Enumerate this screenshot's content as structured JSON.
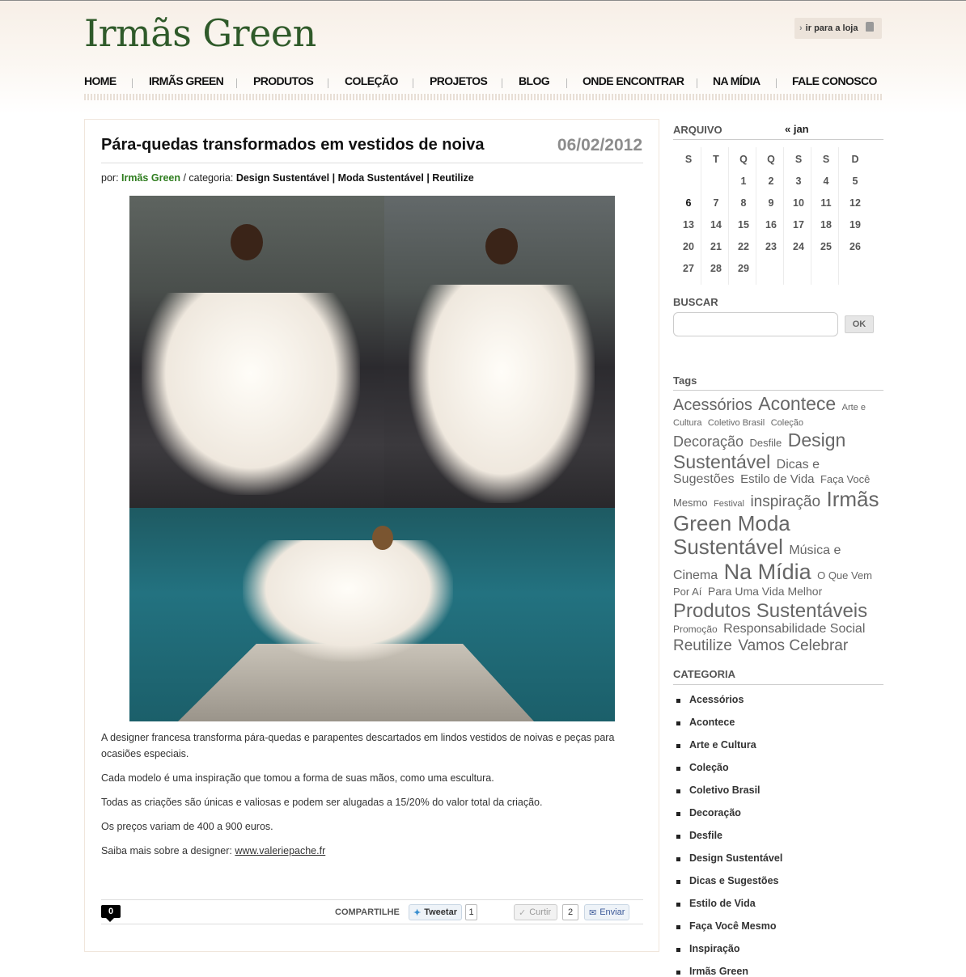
{
  "brand": {
    "logo": "Irmãs Green",
    "store_link": "ir para a loja"
  },
  "nav": [
    "HOME",
    "IRMÃS GREEN",
    "PRODUTOS",
    "COLEÇÃO",
    "PROJETOS",
    "BLOG",
    "ONDE ENCONTRAR",
    "NA MÍDIA",
    "FALE CONOSCO"
  ],
  "post": {
    "title": "Pára-quedas transformados em vestidos de noiva",
    "date": "06/02/2012",
    "by_label": "por:",
    "author": "Irmãs Green",
    "category_label": "/ categoria:",
    "categories": "Design Sustentável | Moda Sustentável | Reutilize",
    "paragraphs": [
      "A designer francesa transforma pára-quedas e parapentes descartados em lindos vestidos de noivas e peças para ocasiões especiais.",
      "Cada modelo é uma inspiração que tomou a forma de suas mãos, como uma escultura.",
      "Todas as criações são únicas e valiosas e podem ser alugadas a 15/20% do valor total da criação.",
      "Os preços variam de 400 a 900 euros."
    ],
    "more_text": "Saiba mais sobre  a designer:",
    "more_link": "www.valeriepache.fr",
    "comments_count": "0",
    "share_label": "COMPARTILHE",
    "tweet_label": "Tweetar",
    "tweet_count": "1",
    "like_label": "Curtir",
    "like_count": "2",
    "send_label": "Enviar"
  },
  "archive": {
    "heading": "ARQUIVO",
    "prev_link": "« jan",
    "weekdays": [
      "S",
      "T",
      "Q",
      "Q",
      "S",
      "S",
      "D"
    ],
    "weeks": [
      [
        "",
        "",
        "1",
        "2",
        "3",
        "4",
        "5"
      ],
      [
        "6",
        "7",
        "8",
        "9",
        "10",
        "11",
        "12"
      ],
      [
        "13",
        "14",
        "15",
        "16",
        "17",
        "18",
        "19"
      ],
      [
        "20",
        "21",
        "22",
        "23",
        "24",
        "25",
        "26"
      ],
      [
        "27",
        "28",
        "29",
        "",
        "",
        "",
        ""
      ]
    ]
  },
  "search": {
    "heading": "BUSCAR",
    "button": "OK",
    "placeholder": ""
  },
  "tags": {
    "heading": "Tags",
    "items": [
      {
        "t": "Acessórios",
        "s": 20
      },
      {
        "t": "Acontece",
        "s": 23
      },
      {
        "t": "Arte e Cultura",
        "s": 11
      },
      {
        "t": "Coletivo Brasil",
        "s": 11
      },
      {
        "t": "Coleção",
        "s": 11
      },
      {
        "t": "Decoração",
        "s": 18
      },
      {
        "t": "Desfile",
        "s": 13
      },
      {
        "t": "Design Sustentável",
        "s": 23
      },
      {
        "t": "Dicas e Sugestões",
        "s": 16
      },
      {
        "t": "Estilo de Vida",
        "s": 15
      },
      {
        "t": "Faça Você Mesmo",
        "s": 13
      },
      {
        "t": "Festival",
        "s": 11
      },
      {
        "t": "inspiração",
        "s": 19
      },
      {
        "t": "Irmãs Green",
        "s": 26
      },
      {
        "t": "Moda Sustentável",
        "s": 26
      },
      {
        "t": "Música e Cinema",
        "s": 16
      },
      {
        "t": "Na Mídia",
        "s": 27
      },
      {
        "t": "O Que Vem Por Aí",
        "s": 13
      },
      {
        "t": "Para Uma Vida Melhor",
        "s": 14
      },
      {
        "t": "Produtos Sustentáveis",
        "s": 24
      },
      {
        "t": "Promoção",
        "s": 12
      },
      {
        "t": "Responsabilidade Social",
        "s": 16
      },
      {
        "t": "Reutilize",
        "s": 19
      },
      {
        "t": "Vamos Celebrar",
        "s": 19
      }
    ]
  },
  "categoria": {
    "heading": "CATEGORIA",
    "items": [
      "Acessórios",
      "Acontece",
      "Arte e Cultura",
      "Coleção",
      "Coletivo Brasil",
      "Decoração",
      "Desfile",
      "Design Sustentável",
      "Dicas e Sugestões",
      "Estilo de Vida",
      "Faça Você Mesmo",
      "Inspiração",
      "Irmãs Green"
    ]
  }
}
